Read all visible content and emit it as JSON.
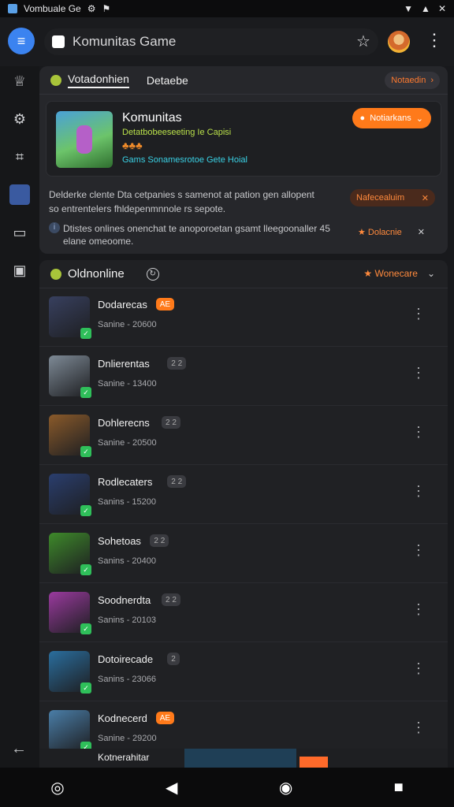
{
  "status_bar": {
    "title": "Vombuale Ge",
    "icons": [
      "wifi-icon",
      "signal-icon",
      "battery-icon"
    ]
  },
  "top_bar": {
    "url_title": "Komunitas Game"
  },
  "tabs": {
    "items": [
      "Votadonhien",
      "Detaebe"
    ],
    "right_chip": "Notaedin"
  },
  "hero": {
    "title": "Komunitas",
    "subtitle": "Detatbobeeseeting Ie Capisi",
    "link": "Gams Sonamesrotoe Gete Hoial",
    "action": "Notiarkans"
  },
  "notices": {
    "text1": "Delderke clente Dta cetpanies s samenot at pation gen allopent so entrentelers fhldepenmnnole rs sepote.",
    "chip1": "Nafecealuim",
    "text2": "Dtistes onlines onenchat te anoporoetan gsamt lleegoonaller 45 elane omeoome.",
    "chip2": "Dolacnie"
  },
  "online": {
    "label": "Oldnonline",
    "right": "Wonecare"
  },
  "games": [
    {
      "name": "Dodarecas",
      "tag": "AE",
      "stat": "Sanine - 20600",
      "icon": "#38405f",
      "tag_color": "#ff7a1a",
      "tag_text": "#fff"
    },
    {
      "name": "Dnlierentas",
      "tag": "2 2",
      "stat": "Sanine - 13400",
      "icon": "#7e8a96",
      "tag_color": "#3a3b40",
      "tag_text": "#aaa"
    },
    {
      "name": "Dohlerecns",
      "tag": "2 2",
      "stat": "Sanine - 20500",
      "icon": "#8a5a2a",
      "tag_color": "#3a3b40",
      "tag_text": "#aaa"
    },
    {
      "name": "Rodlecaters",
      "tag": "2 2",
      "stat": "Sanins - 15200",
      "icon": "#2a3e6e",
      "tag_color": "#3a3b40",
      "tag_text": "#aaa"
    },
    {
      "name": "Sohetoas",
      "tag": "2 2",
      "stat": "Sanins - 20400",
      "icon": "#3e8a2a",
      "tag_color": "#3a3b40",
      "tag_text": "#aaa"
    },
    {
      "name": "Soodnerdta",
      "tag": "2 2",
      "stat": "Sanins - 20103",
      "icon": "#9a3a9e",
      "tag_color": "#3a3b40",
      "tag_text": "#aaa"
    },
    {
      "name": "Dotoirecade",
      "tag": "2",
      "stat": "Sanins - 23066",
      "icon": "#2a6e9e",
      "tag_color": "#3a3b40",
      "tag_text": "#aaa"
    },
    {
      "name": "Kodnecerd",
      "tag": "AE",
      "stat": "Sanine - 29200",
      "icon": "#4a7ea8",
      "tag_color": "#ff7a1a",
      "tag_text": "#fff"
    }
  ],
  "peek_row": {
    "name": "Kotnerahitar"
  }
}
